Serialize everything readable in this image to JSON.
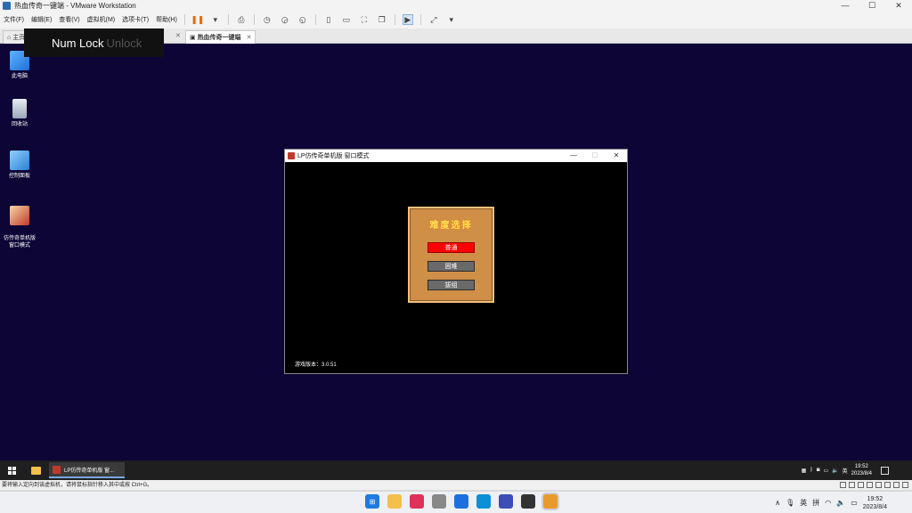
{
  "window": {
    "title": "热血传奇一键端 - VMware Workstation",
    "min": "—",
    "max": "☐",
    "close": "✕"
  },
  "menu": {
    "items": [
      "文件(F)",
      "编辑(E)",
      "查看(V)",
      "虚拟机(M)",
      "选项卡(T)",
      "帮助(H)"
    ]
  },
  "tabs": {
    "home": "主页",
    "active": "热血传奇一键端"
  },
  "osd": {
    "numlock_on": "Num Lock",
    "numlock_off": "Unlock"
  },
  "desktop": {
    "icons": [
      {
        "label": "此电脑"
      },
      {
        "label": "回收站"
      },
      {
        "label": "控制面板"
      },
      {
        "label": "仿传奇单机版\n窗口模式"
      }
    ]
  },
  "game": {
    "window_title": "LP仿传奇单机版 窗口模式",
    "dialog_title": "难度选择",
    "buttons": [
      "普通",
      "困难",
      "拔组"
    ],
    "version": "游戏版本：3.0.51"
  },
  "guest_taskbar": {
    "task_label": "LP仿传奇单机版 窗...",
    "ime": "英",
    "time": "19:52",
    "date": "2023/8/4"
  },
  "statusbar": {
    "text": "要将输入定向到该虚拟机，请将鼠标指针移入其中或按 Ctrl+G。"
  },
  "host_taskbar": {
    "ime1": "英",
    "ime2": "拼",
    "time": "19:52",
    "date": "2023/8/4"
  }
}
